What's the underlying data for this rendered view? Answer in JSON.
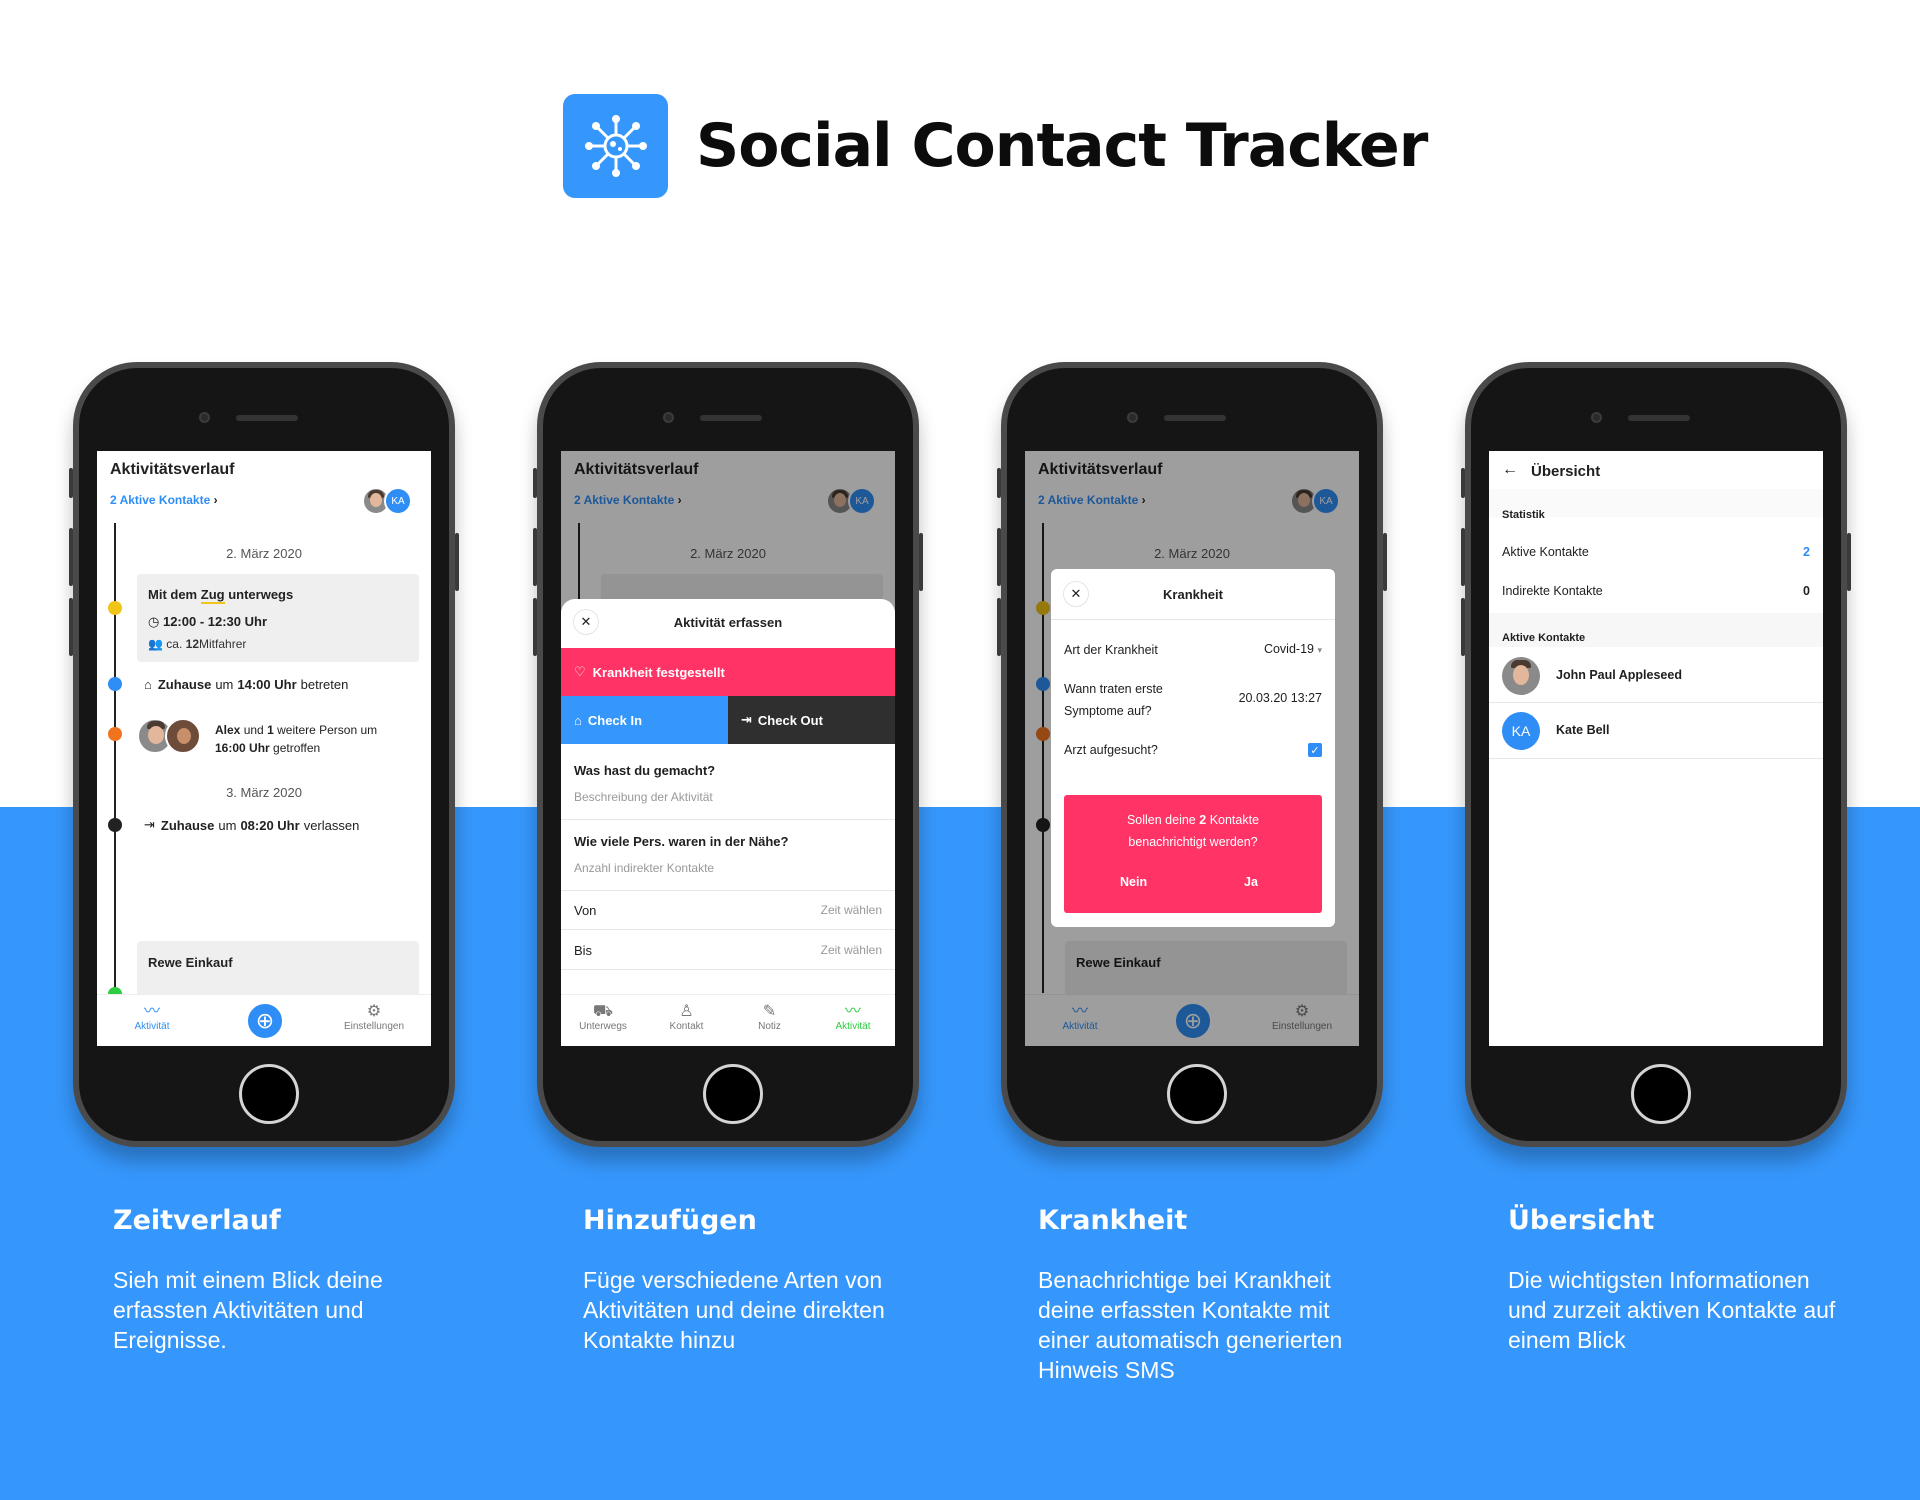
{
  "header": {
    "title": "Social Contact Tracker"
  },
  "common": {
    "screen_title": "Aktivitätsverlauf",
    "contacts_link": "2 Aktive Kontakte",
    "avatar_initials": "KA",
    "date1": "2. März 2020",
    "date2": "3. März 2020"
  },
  "screen1": {
    "card1_title_a": "Mit dem",
    "card1_title_b": "Zug",
    "card1_title_c": "unterwegs",
    "card1_time": "12:00 - 12:30 Uhr",
    "card1_people_a": "ca.",
    "card1_people_b": "12",
    "card1_people_c": "Mitfahrer",
    "ev1_a": "Zuhause",
    "ev1_b": "um",
    "ev1_c": "14:00 Uhr",
    "ev1_d": "betreten",
    "ev2_a": "Alex",
    "ev2_b": "und",
    "ev2_c": "1",
    "ev2_d": "weitere Person um",
    "ev2_e": "16:00 Uhr",
    "ev2_f": "getroffen",
    "ev3_a": "Zuhause",
    "ev3_b": "um",
    "ev3_c": "08:20 Uhr",
    "ev3_d": "verlassen",
    "card2_title": "Rewe Einkauf",
    "nav_left": "Aktivität",
    "nav_right": "Einstellungen"
  },
  "screen2": {
    "sheet_title": "Aktivität erfassen",
    "illness_btn": "Krankheit festgestellt",
    "checkin": "Check In",
    "checkout": "Check Out",
    "q1": "Was hast du gemacht?",
    "q1_placeholder": "Beschreibung der Aktivität",
    "q2": "Wie viele Pers. waren in der Nähe?",
    "q2_placeholder": "Anzahl indirekter Kontakte",
    "von": "Von",
    "bis": "Bis",
    "zeit": "Zeit wählen",
    "nav": [
      "Unterwegs",
      "Kontakt",
      "Notiz",
      "Aktivität"
    ]
  },
  "screen3": {
    "modal_title": "Krankheit",
    "art_label": "Art der Krankheit",
    "art_value": "Covid-19",
    "symptom_label_1": "Wann traten erste",
    "symptom_label_2": "Symptome auf?",
    "symptom_value": "20.03.20 13:27",
    "arzt_label": "Arzt aufgesucht?",
    "arzt_checked": true,
    "notify_a": "Sollen deine",
    "notify_b": "2",
    "notify_c": "Kontakte",
    "notify_d": "benachrichtigt werden?",
    "no": "Nein",
    "yes": "Ja"
  },
  "screen4": {
    "title": "Übersicht",
    "stats_heading": "Statistik",
    "active_label": "Aktive Kontakte",
    "active_value": "2",
    "indirect_label": "Indirekte Kontakte",
    "indirect_value": "0",
    "list_heading": "Aktive Kontakte",
    "contact1": "John Paul Appleseed",
    "contact2": "Kate Bell",
    "contact2_initials": "KA"
  },
  "captions": [
    {
      "title": "Zeitverlauf",
      "text": "Sieh mit einem Blick deine erfassten Aktivitäten und Ereignisse."
    },
    {
      "title": "Hinzufügen",
      "text": "Füge verschiedene Arten von Aktivitäten und deine direkten Kontakte hinzu"
    },
    {
      "title": "Krankheit",
      "text": "Benachrichtige bei Krankheit deine erfassten Kontakte mit einer automatisch generierten Hinweis SMS"
    },
    {
      "title": "Übersicht",
      "text": "Die wichtigsten Informationen und zurzeit aktiven Kontakte auf einem Blick"
    }
  ],
  "colors": {
    "blue": "#3596fb",
    "pink": "#ff3366",
    "dark": "#2f2f2f",
    "yellow": "#f0c419",
    "orange": "#f0741e",
    "green": "#2ecc40"
  }
}
